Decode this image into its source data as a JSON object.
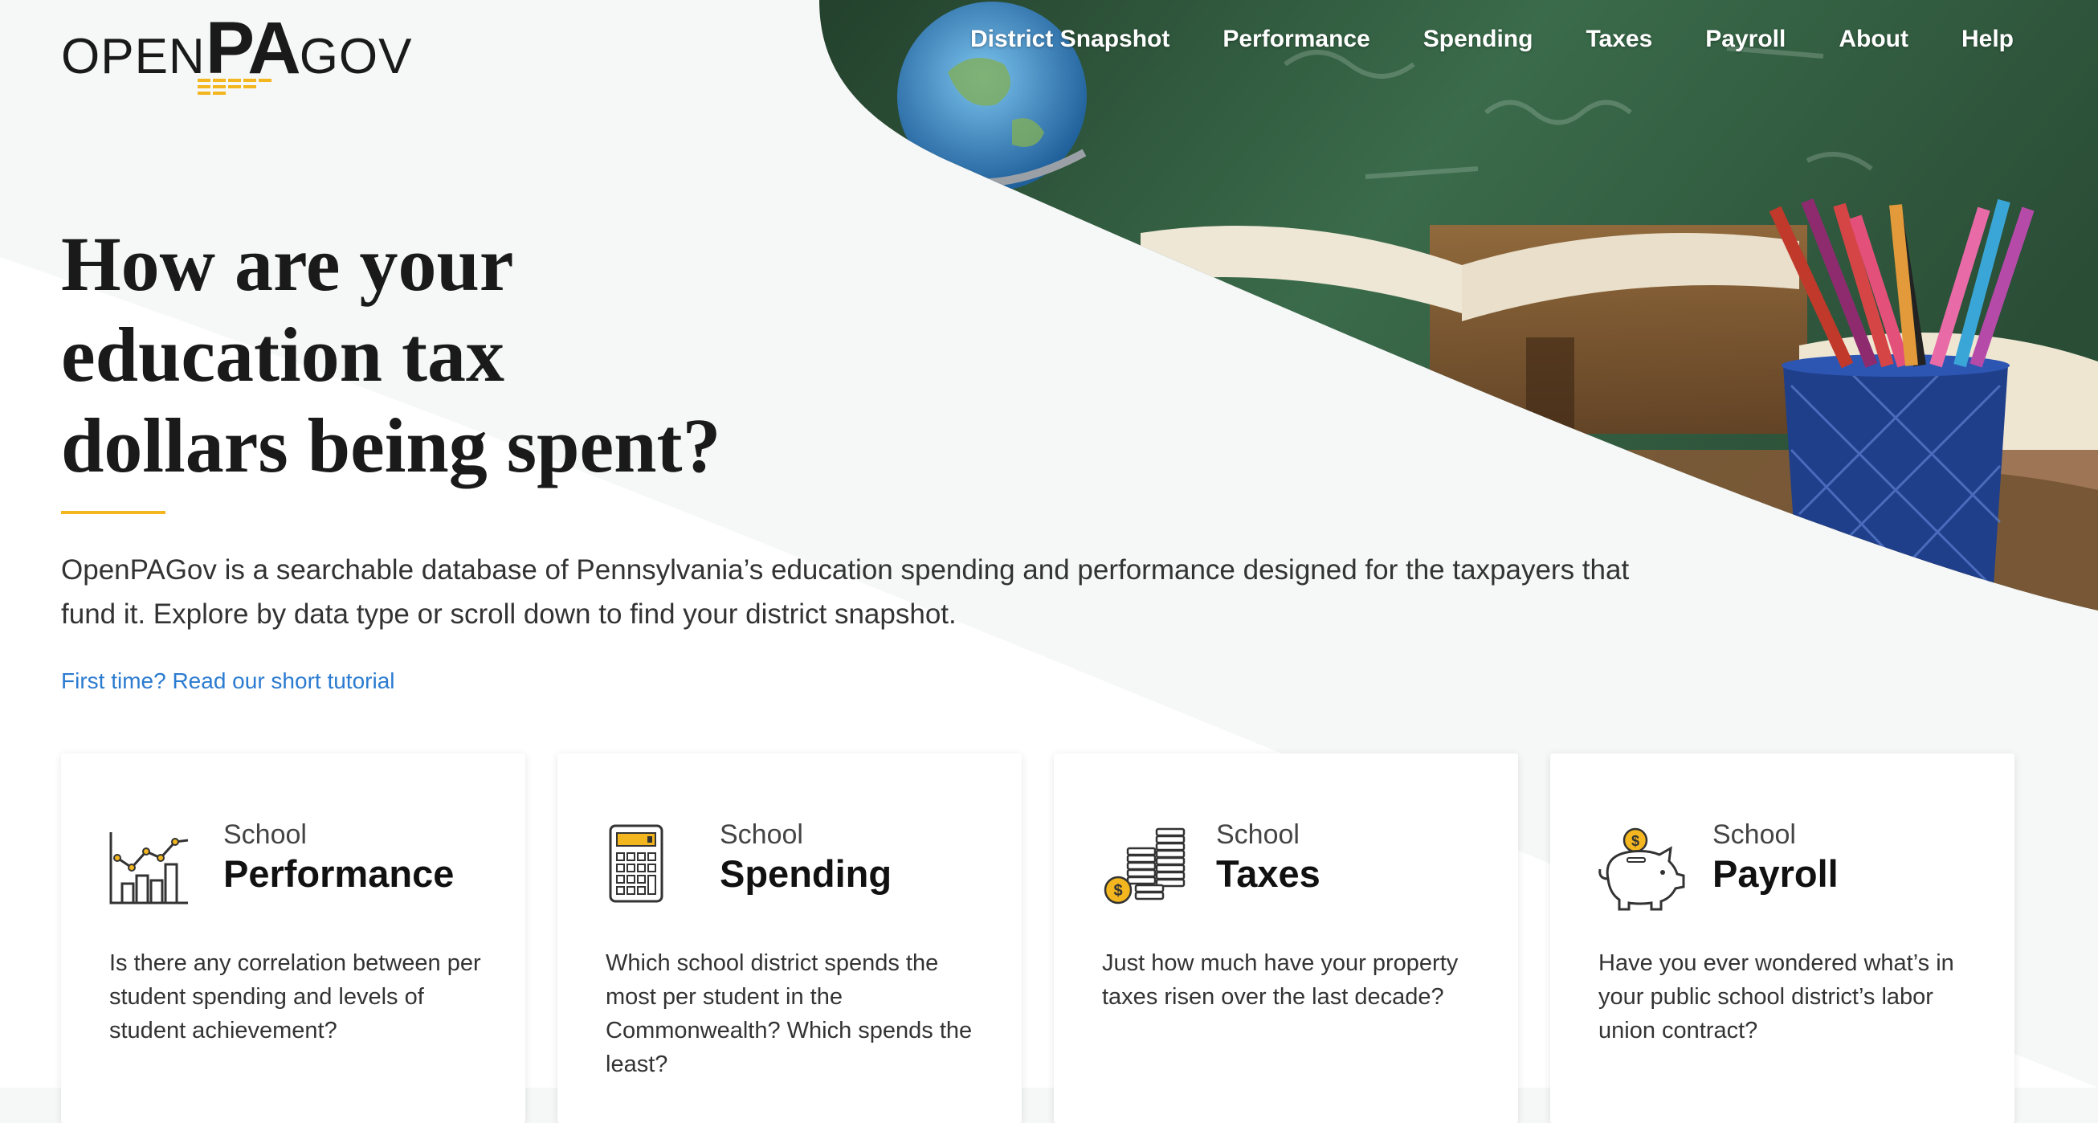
{
  "logo": {
    "open": "OPEN",
    "pa": "PA",
    "gov": "GOV"
  },
  "nav": {
    "items": [
      "District Snapshot",
      "Performance",
      "Spending",
      "Taxes",
      "Payroll",
      "About",
      "Help"
    ]
  },
  "hero": {
    "headline_lines": [
      "How are your",
      "education tax",
      "dollars being spent?"
    ],
    "intro": "OpenPAGov is a searchable database of Pennsylvania’s education spending and performance designed for the taxpayers that fund it. Explore by data type or scroll down to find your district snapshot.",
    "tutorial_link": "First time? Read our short tutorial"
  },
  "cards": [
    {
      "kicker": "School",
      "title": "Performance",
      "icon": "chart-icon",
      "desc": "Is there any correlation between per student spending and levels of student achievement?"
    },
    {
      "kicker": "School",
      "title": "Spending",
      "icon": "calculator-icon",
      "desc": "Which school district spends the most per student in the Commonwealth? Which spends the least?"
    },
    {
      "kicker": "School",
      "title": "Taxes",
      "icon": "coins-icon",
      "desc": "Just how much have your property taxes risen over the last decade?"
    },
    {
      "kicker": "School",
      "title": "Payroll",
      "icon": "piggy-bank-icon",
      "desc": "Have you ever wondered what’s in your public school district’s labor union contract?"
    }
  ],
  "colors": {
    "accent": "#f3b61f",
    "link": "#2b7bd0",
    "chalkboard": "#2e5a3c"
  }
}
